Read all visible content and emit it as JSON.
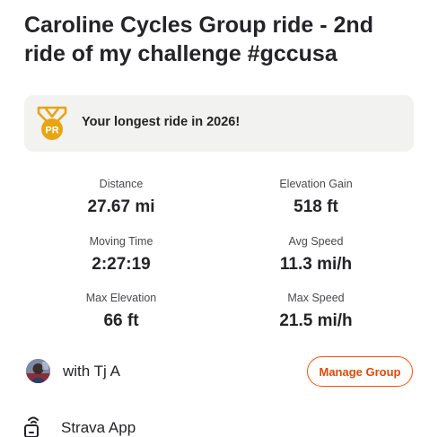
{
  "activity": {
    "title": "Caroline Cycles Group ride - 2nd ride of my challenge #gccusa"
  },
  "achievement": {
    "badge_text": "PR",
    "text": "Your longest ride in 2026!",
    "icon": "pr-medal-icon",
    "accent_color": "#e8a413"
  },
  "stats": [
    {
      "label": "Distance",
      "value": "27.67 mi"
    },
    {
      "label": "Elevation Gain",
      "value": "518 ft"
    },
    {
      "label": "Moving Time",
      "value": "2:27:19"
    },
    {
      "label": "Avg Speed",
      "value": "11.3 mi/h"
    },
    {
      "label": "Max Elevation",
      "value": "66 ft"
    },
    {
      "label": "Max Speed",
      "value": "21.5 mi/h"
    }
  ],
  "group": {
    "with_text": "with Tj A",
    "manage_label": "Manage Group",
    "accent_color": "#fc5200"
  },
  "device": {
    "icon": "device-sync-icon",
    "name": "Strava App"
  }
}
